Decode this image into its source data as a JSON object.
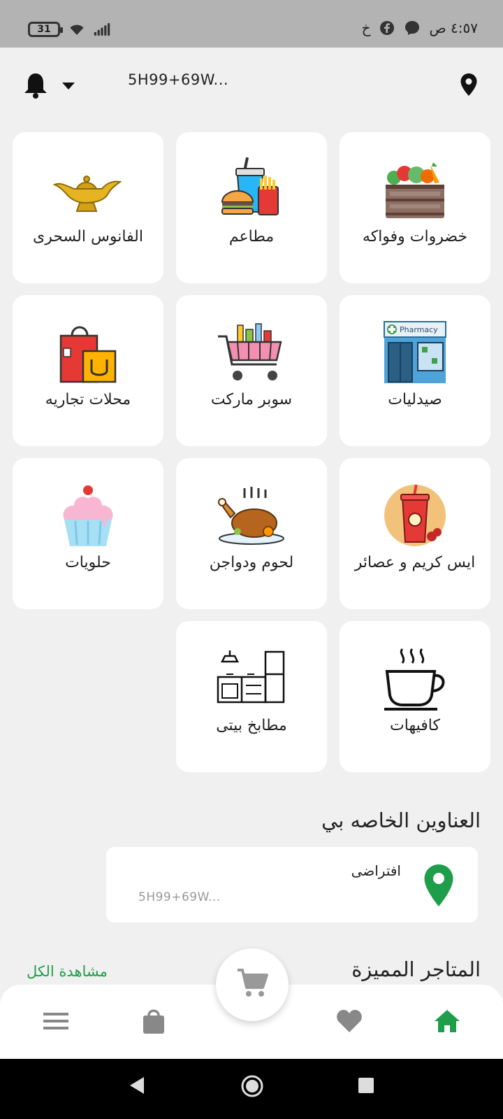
{
  "status_bar": {
    "battery": "31",
    "time": "٤:٥٧ ص",
    "extra_icon": "خ",
    "icons": [
      "wifi-icon",
      "signal-icon",
      "messenger-icon",
      "facebook-icon"
    ]
  },
  "header": {
    "address": "5H99+69W...",
    "icons": [
      "bell-icon",
      "caret-down-icon",
      "location-pin-icon"
    ]
  },
  "categories": [
    {
      "label": "خضروات وفواكه",
      "icon": "vegetables-crate-icon"
    },
    {
      "label": "مطاعم",
      "icon": "fast-food-icon"
    },
    {
      "label": "الفانوس السحرى",
      "icon": "magic-lamp-icon"
    },
    {
      "label": "صيدليات",
      "icon": "pharmacy-store-icon",
      "sign_text": "Pharmacy"
    },
    {
      "label": "سوبر ماركت",
      "icon": "shopping-cart-icon"
    },
    {
      "label": "محلات تجاريه",
      "icon": "shopping-bags-icon"
    },
    {
      "label": "ايس كريم و عصائر",
      "icon": "juice-cup-icon"
    },
    {
      "label": "لحوم ودواجن",
      "icon": "roast-chicken-icon"
    },
    {
      "label": "حلويات",
      "icon": "cupcake-icon"
    },
    {
      "label": "كافيهات",
      "icon": "coffee-cup-icon"
    },
    {
      "label": "مطابخ بيتى",
      "icon": "kitchen-icon"
    }
  ],
  "my_addresses": {
    "title": "العناوين الخاصه بي",
    "items": [
      {
        "name": "افتراضى",
        "address": "5H99+69W..."
      }
    ]
  },
  "featured": {
    "title": "المتاجر المميزة",
    "see_all": "مشاهدة الكل"
  },
  "bottom_nav": {
    "items": [
      "home-icon",
      "heart-icon",
      "cart-icon",
      "bag-icon",
      "menu-icon"
    ],
    "active": "home-icon"
  },
  "colors": {
    "accent": "#1e9e4a",
    "status_bar": "#b3b3b3",
    "background": "#f0f0f0",
    "card": "#ffffff",
    "system_nav": "#000000"
  }
}
